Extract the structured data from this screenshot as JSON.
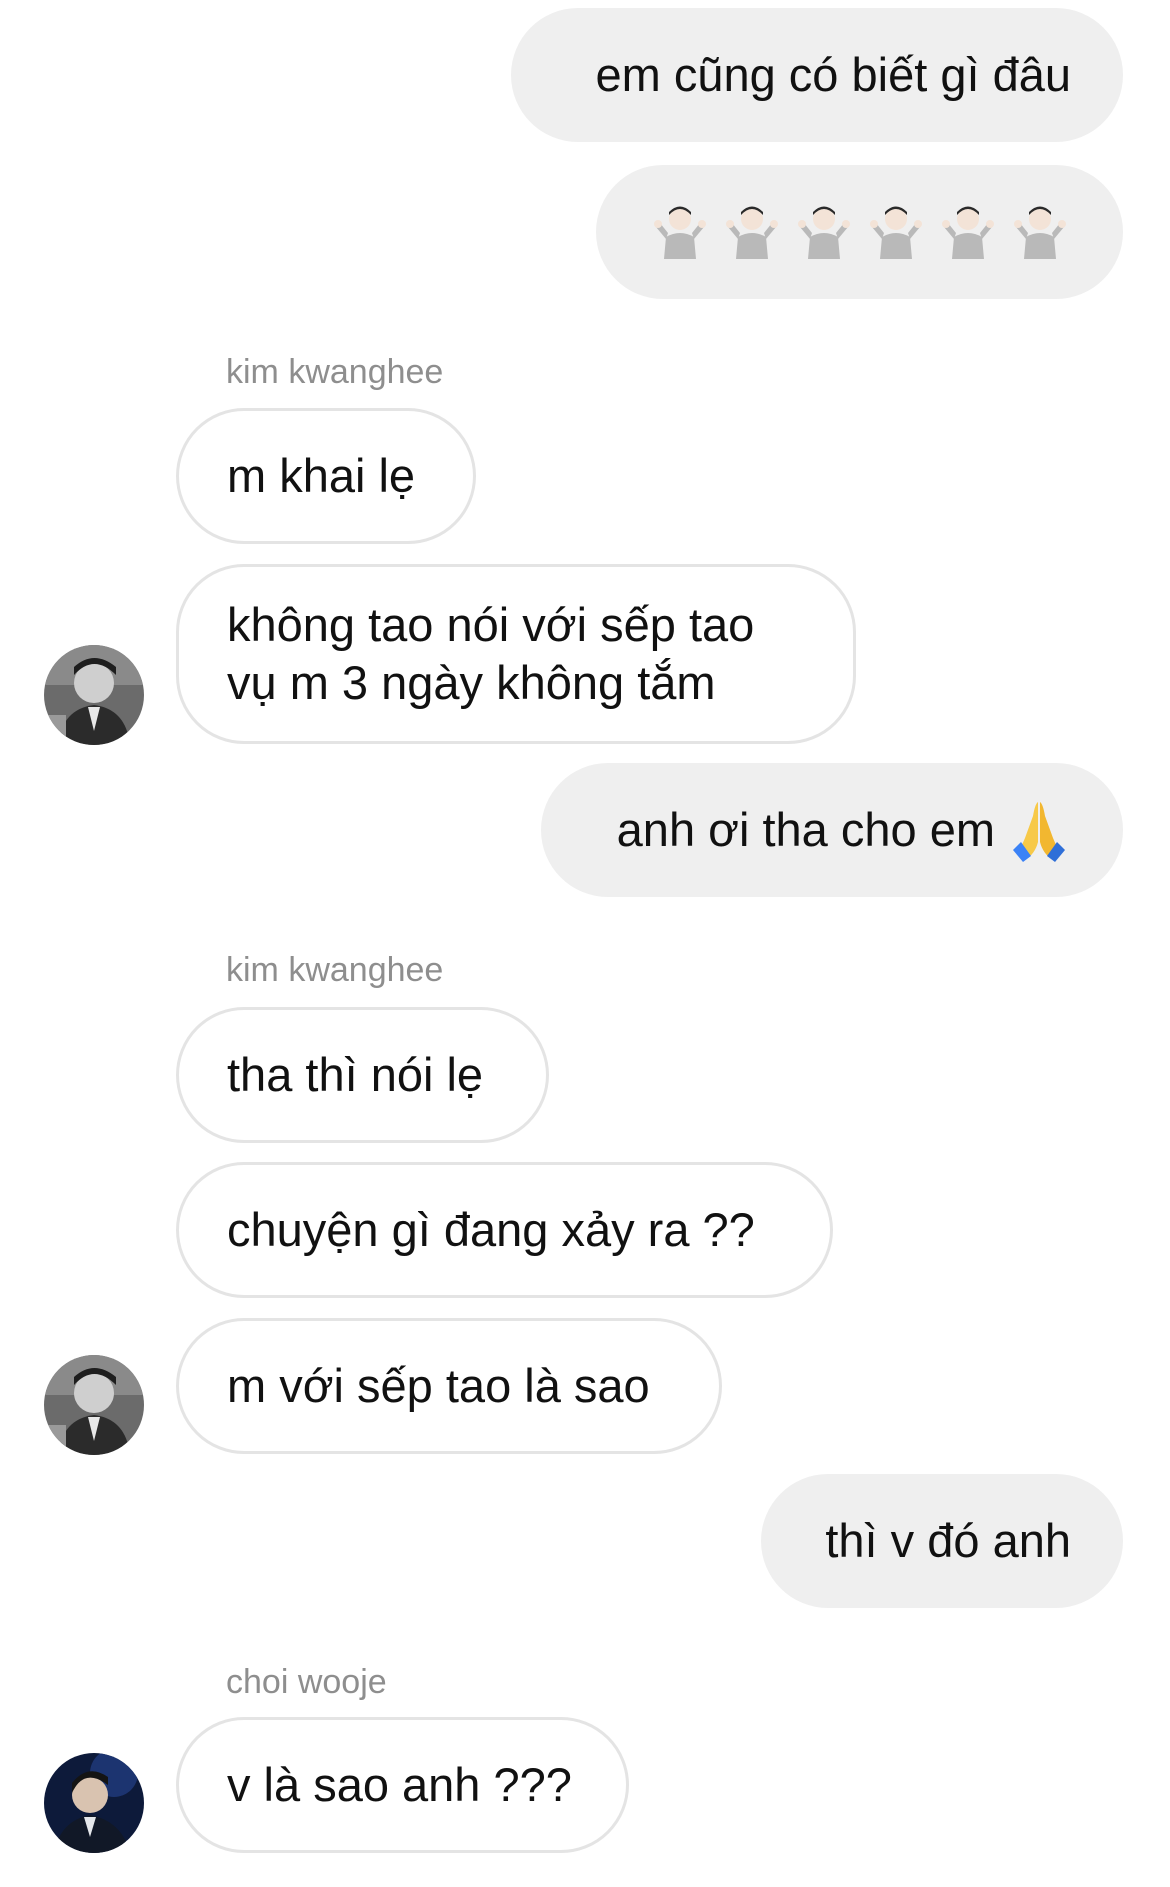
{
  "conversation": {
    "messages": [
      {
        "direction": "outgoing",
        "text": "em cũng có biết gì đâu"
      },
      {
        "direction": "outgoing",
        "emojis": [
          "person-shrugging-icon",
          "person-shrugging-icon",
          "person-shrugging-icon",
          "person-shrugging-icon",
          "person-shrugging-icon",
          "person-shrugging-icon"
        ]
      },
      {
        "direction": "incoming",
        "sender": "kim kwanghee",
        "text": "m khai lẹ"
      },
      {
        "direction": "incoming",
        "text_line1": "không tao nói với sếp tao",
        "text_line2": "vụ m 3 ngày không tắm"
      },
      {
        "direction": "outgoing",
        "text": "anh ơi tha cho em",
        "emoji": "folded-hands-icon"
      },
      {
        "direction": "incoming",
        "sender": "kim kwanghee",
        "text": "tha thì nói lẹ"
      },
      {
        "direction": "incoming",
        "text": "chuyện gì đang xảy ra ??"
      },
      {
        "direction": "incoming",
        "text": "m với sếp tao là sao"
      },
      {
        "direction": "outgoing",
        "text": "thì v đó anh"
      },
      {
        "direction": "incoming",
        "sender": "choi wooje",
        "text": "v là sao anh ???"
      }
    ]
  },
  "colors": {
    "outgoing_bubble": "#efefef",
    "incoming_border": "#e4e4e4",
    "sender_name": "#8e8e8e",
    "text": "#111111"
  }
}
